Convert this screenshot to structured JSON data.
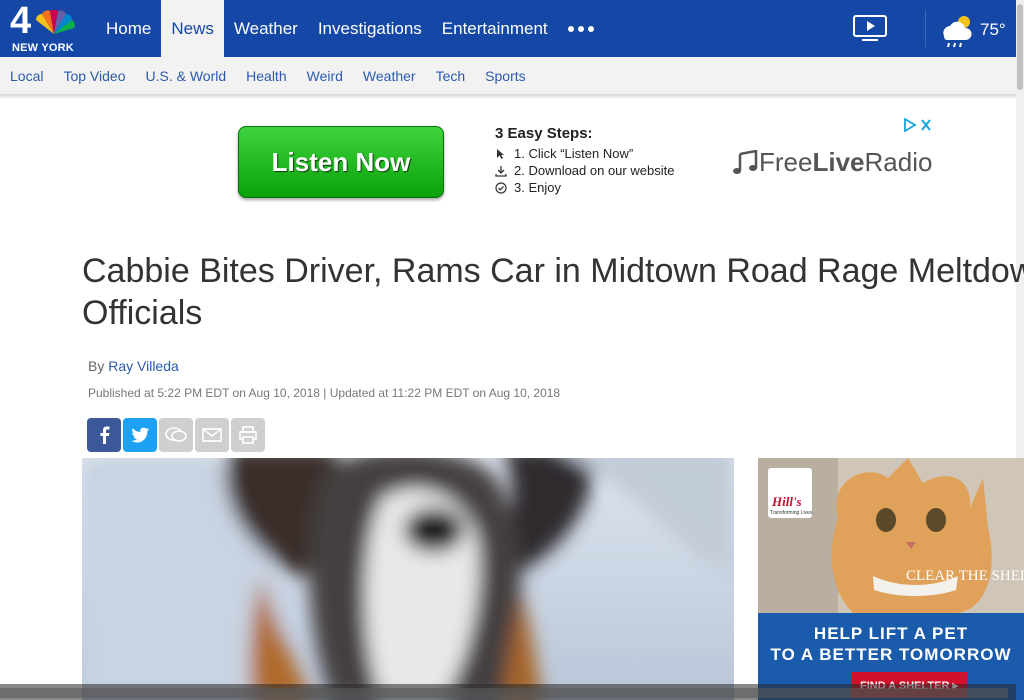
{
  "header": {
    "logo_number": "4",
    "logo_city": "NEW YORK",
    "nav": [
      "Home",
      "News",
      "Weather",
      "Investigations",
      "Entertainment"
    ],
    "active_nav": "News",
    "temperature": "75°"
  },
  "subnav": [
    "Local",
    "Top Video",
    "U.S. & World",
    "Health",
    "Weird",
    "Weather",
    "Tech",
    "Sports"
  ],
  "ad": {
    "button": "Listen Now",
    "steps_title": "3 Easy Steps:",
    "steps": [
      "1. Click “Listen Now”",
      "2. Download on our website",
      "3. Enjoy"
    ],
    "brand_a": "Free",
    "brand_b": "Live",
    "brand_c": "Radio"
  },
  "article": {
    "headline": "Cabbie Bites Driver, Rams Car in Midtown Road Rage Meltdown: Officials",
    "byline_prefix": "By",
    "author": "Ray Villeda",
    "published": "Published at 5:22 PM EDT on Aug 10, 2018 | Updated at 11:22 PM EDT on Aug 10, 2018"
  },
  "side_ad": {
    "brand": "Hill's",
    "brand_sub": "Transforming Lives",
    "partner": "CLEAR THE SHELTERS",
    "tagline_1": "HELP LIFT A PET",
    "tagline_2": "TO A BETTER TOMORROW",
    "cta": "FIND A SHELTER ▸"
  },
  "colors": {
    "nav_blue": "#1447a6",
    "link_blue": "#2b5aad",
    "listen_green": "#19b519"
  }
}
